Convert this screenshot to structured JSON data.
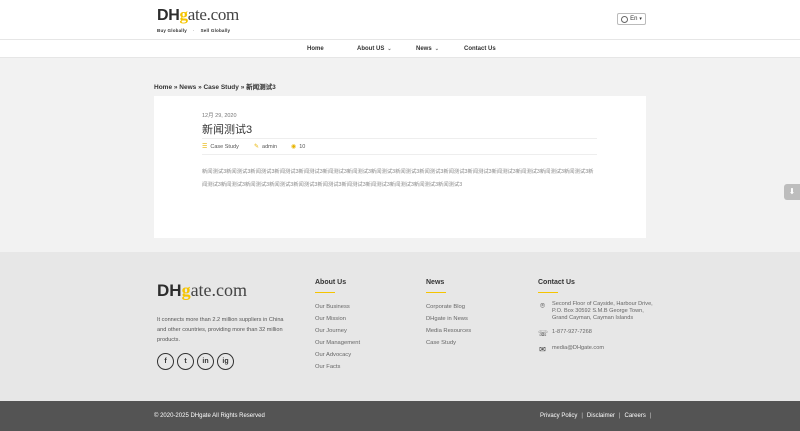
{
  "header": {
    "logo": {
      "dh": "DH",
      "g": "g",
      "rest": "ate.com"
    },
    "tagline": {
      "left": "Buy Globally",
      "dot": "·",
      "right": "Sell Globally"
    },
    "language": "En"
  },
  "nav": {
    "items": [
      {
        "label": "Home"
      },
      {
        "label": "About US"
      },
      {
        "label": "News"
      },
      {
        "label": "Contact Us"
      }
    ]
  },
  "breadcrumb": "Home » News » Case Study » 新闻测试3",
  "post": {
    "date": "12月 29, 2020",
    "title": "新闻测试3",
    "category": "Case Study",
    "author": "admin",
    "views": "10",
    "body": "新闻测试3新闻测试3新闻测试3新闻测试3新闻测试3新闻测试3新闻测试3新闻测试3新闻测试3新闻测试3新闻测试3新闻测试3新闻测试3新闻测试3新闻测试3新闻测试3新闻测试3新闻测试3新闻测试3新闻测试3新闻测试3新闻测试3新闻测试3新闻测试3新闻测试3新闻测试3新闻测试3"
  },
  "footer": {
    "logo": {
      "dh": "DH",
      "g": "g",
      "rest": "ate.com"
    },
    "description": "It connects more than 2.2 million suppliers in China and other countries, providing more than 32 million products.",
    "socials": [
      "f",
      "t",
      "in",
      "ig"
    ],
    "about": {
      "title": "About Us",
      "links": [
        "Our Business",
        "Our Mission",
        "Our Journey",
        "Our Management",
        "Our Advocacy",
        "Our Facts"
      ]
    },
    "news": {
      "title": "News",
      "links": [
        "Corporate Blog",
        "DHgate in News",
        "Media Resources",
        "Case Study"
      ]
    },
    "contact": {
      "title": "Contact Us",
      "address": "Second Floor of Cayside, Harbour Drive, P.O. Box 30592 S.M.B George Town, Grand Cayman, Cayman Islands",
      "phone": "1-877-927-7268",
      "email": "media@DHgate.com"
    },
    "copyright": "© 2020-2025 DHgate All Rights Reserved",
    "bottom_links": [
      "Privacy Policy",
      "Disclaimer",
      "Careers"
    ],
    "separator": "|"
  },
  "icons": {
    "category": "category-icon",
    "author": "pen-icon",
    "views": "eye-icon",
    "scroll_top": "download-icon"
  },
  "colors": {
    "accent": "#f5c400",
    "bottom_bar": "#545454",
    "footer_bg": "#e7e7e7"
  }
}
